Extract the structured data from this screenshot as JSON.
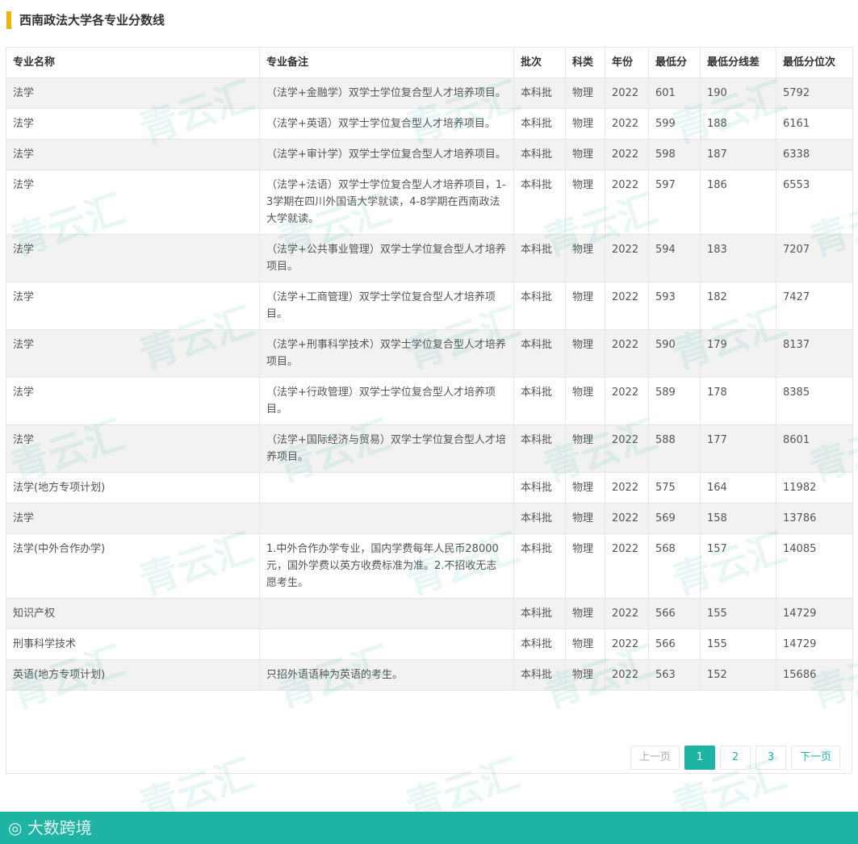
{
  "page": {
    "title": "西南政法大学各专业分数线",
    "accent_color": "#f0b400",
    "brand_color": "#1eb3a3"
  },
  "table": {
    "headers": [
      "专业名称",
      "专业备注",
      "批次",
      "科类",
      "年份",
      "最低分",
      "最低分线差",
      "最低分位次"
    ],
    "rows": [
      [
        "法学",
        "（法学+金融学）双学士学位复合型人才培养项目。",
        "本科批",
        "物理",
        "2022",
        "601",
        "190",
        "5792"
      ],
      [
        "法学",
        "（法学+英语）双学士学位复合型人才培养项目。",
        "本科批",
        "物理",
        "2022",
        "599",
        "188",
        "6161"
      ],
      [
        "法学",
        "（法学+审计学）双学士学位复合型人才培养项目。",
        "本科批",
        "物理",
        "2022",
        "598",
        "187",
        "6338"
      ],
      [
        "法学",
        "（法学+法语）双学士学位复合型人才培养项目，1-3学期在四川外国语大学就读，4-8学期在西南政法大学就读。",
        "本科批",
        "物理",
        "2022",
        "597",
        "186",
        "6553"
      ],
      [
        "法学",
        "（法学+公共事业管理）双学士学位复合型人才培养项目。",
        "本科批",
        "物理",
        "2022",
        "594",
        "183",
        "7207"
      ],
      [
        "法学",
        "（法学+工商管理）双学士学位复合型人才培养项目。",
        "本科批",
        "物理",
        "2022",
        "593",
        "182",
        "7427"
      ],
      [
        "法学",
        "（法学+刑事科学技术）双学士学位复合型人才培养项目。",
        "本科批",
        "物理",
        "2022",
        "590",
        "179",
        "8137"
      ],
      [
        "法学",
        "（法学+行政管理）双学士学位复合型人才培养项目。",
        "本科批",
        "物理",
        "2022",
        "589",
        "178",
        "8385"
      ],
      [
        "法学",
        "（法学+国际经济与贸易）双学士学位复合型人才培养项目。",
        "本科批",
        "物理",
        "2022",
        "588",
        "177",
        "8601"
      ],
      [
        "法学(地方专项计划)",
        "",
        "本科批",
        "物理",
        "2022",
        "575",
        "164",
        "11982"
      ],
      [
        "法学",
        "",
        "本科批",
        "物理",
        "2022",
        "569",
        "158",
        "13786"
      ],
      [
        "法学(中外合作办学)",
        "1.中外合作办学专业，国内学费每年人民币28000元，国外学费以英方收费标准为准。2.不招收无志愿考生。",
        "本科批",
        "物理",
        "2022",
        "568",
        "157",
        "14085"
      ],
      [
        "知识产权",
        "",
        "本科批",
        "物理",
        "2022",
        "566",
        "155",
        "14729"
      ],
      [
        "刑事科学技术",
        "",
        "本科批",
        "物理",
        "2022",
        "566",
        "155",
        "14729"
      ],
      [
        "英语(地方专项计划)",
        "只招外语语种为英语的考生。",
        "本科批",
        "物理",
        "2022",
        "563",
        "152",
        "15686"
      ]
    ]
  },
  "pagination": {
    "prev_label": "上一页",
    "pages": [
      "1",
      "2",
      "3"
    ],
    "current": "1",
    "next_label": "下一页"
  },
  "watermark": {
    "text": "青云汇"
  },
  "footer": {
    "text": "大数跨境",
    "icon": "brand-logo-icon"
  }
}
